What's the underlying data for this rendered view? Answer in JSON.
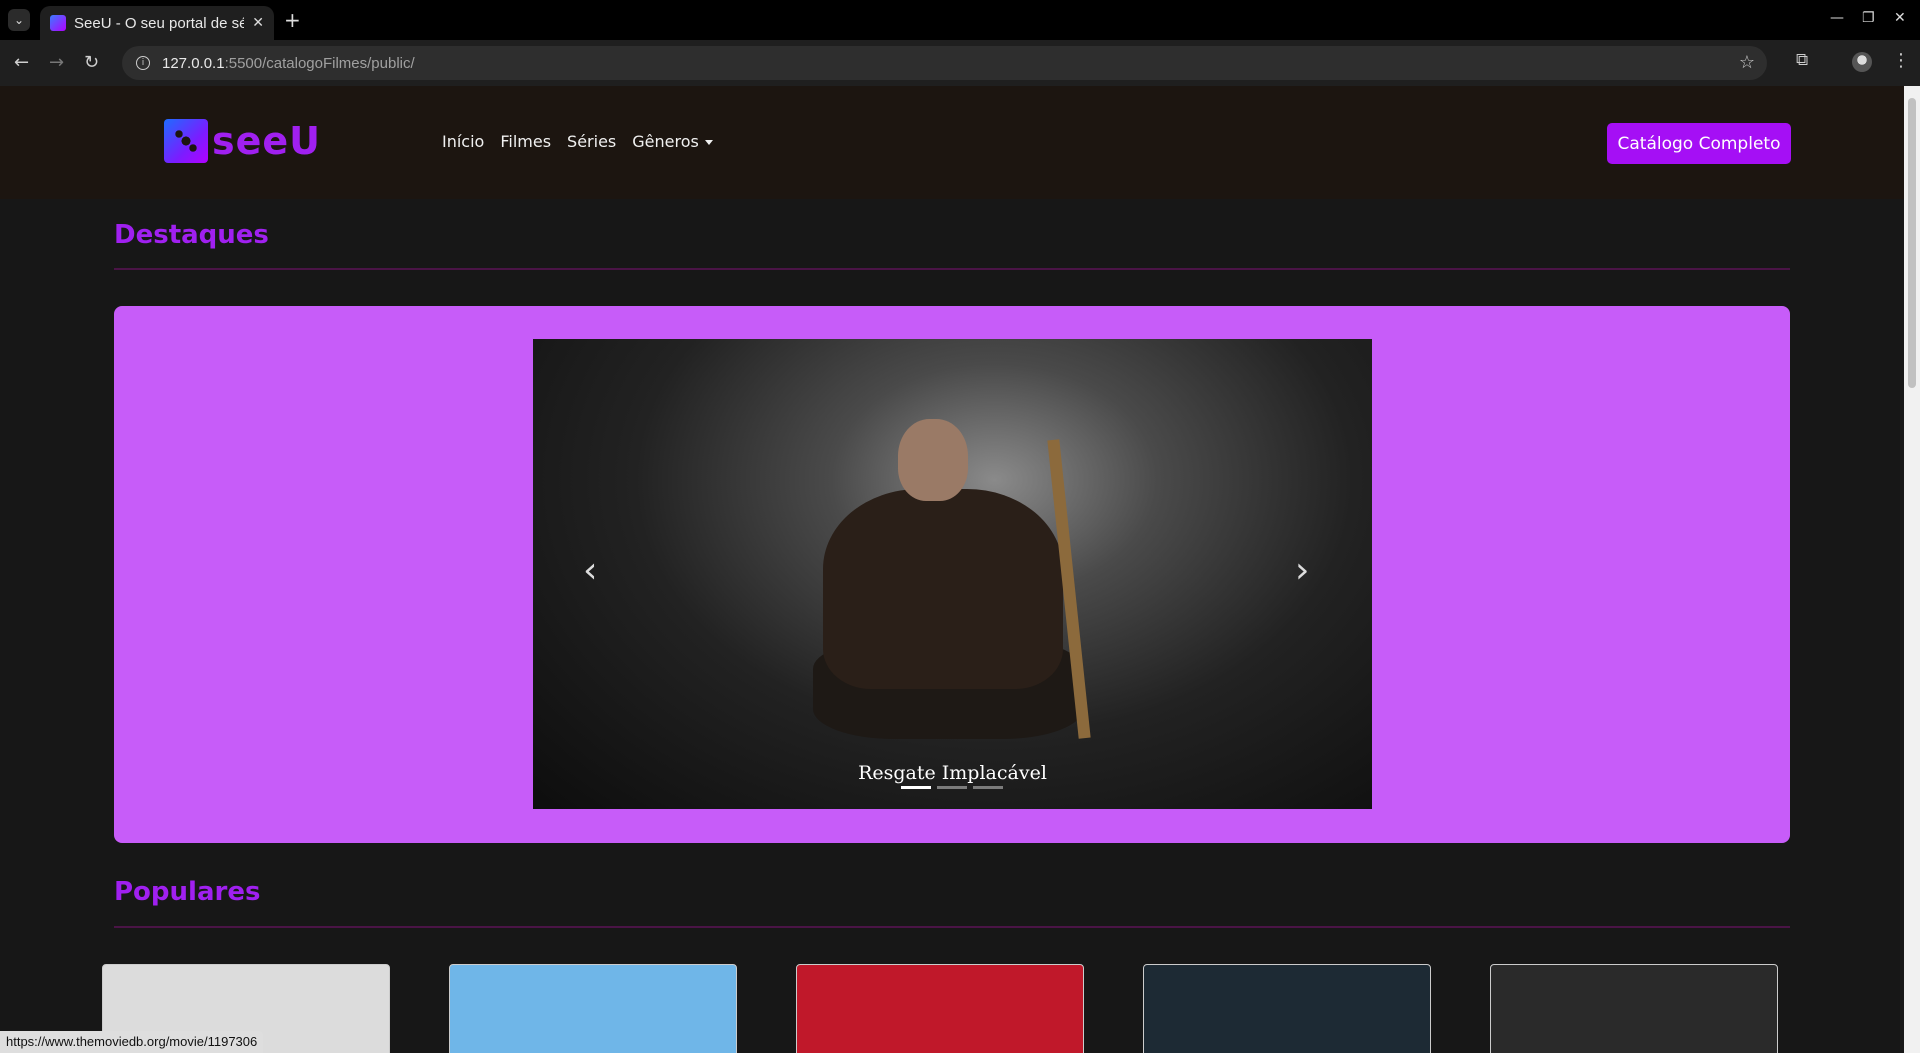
{
  "browser": {
    "tab_title": "SeeU - O seu portal de séries e filmes",
    "url_host": "127.0.0.1",
    "url_path": ":5500/catalogoFilmes/public/"
  },
  "navbar": {
    "logo_text": "seeU",
    "links": [
      "Início",
      "Filmes",
      "Séries",
      "Gêneros"
    ],
    "catalog_button": "Catálogo Completo"
  },
  "sections": {
    "highlights_title": "Destaques",
    "popular_title": "Populares"
  },
  "carousel": {
    "caption": "Resgate Implacável",
    "slide_count": 3,
    "active_index": 0
  },
  "posters": [
    {
      "alt": "poster-1",
      "color": "#dcdcdc"
    },
    {
      "alt": "poster-2",
      "color": "#6fb6e8"
    },
    {
      "alt": "poster-3",
      "color": "#c0182a"
    },
    {
      "alt": "poster-4",
      "color": "#1d2a34"
    },
    {
      "alt": "poster-5",
      "color": "#2a2a2a"
    }
  ],
  "status_url": "https://www.themoviedb.org/movie/1197306",
  "colors": {
    "accent": "#a50ff5",
    "carousel_bg": "#c75cf9",
    "page_bg": "#171717",
    "navbar_bg": "#1c1510"
  }
}
